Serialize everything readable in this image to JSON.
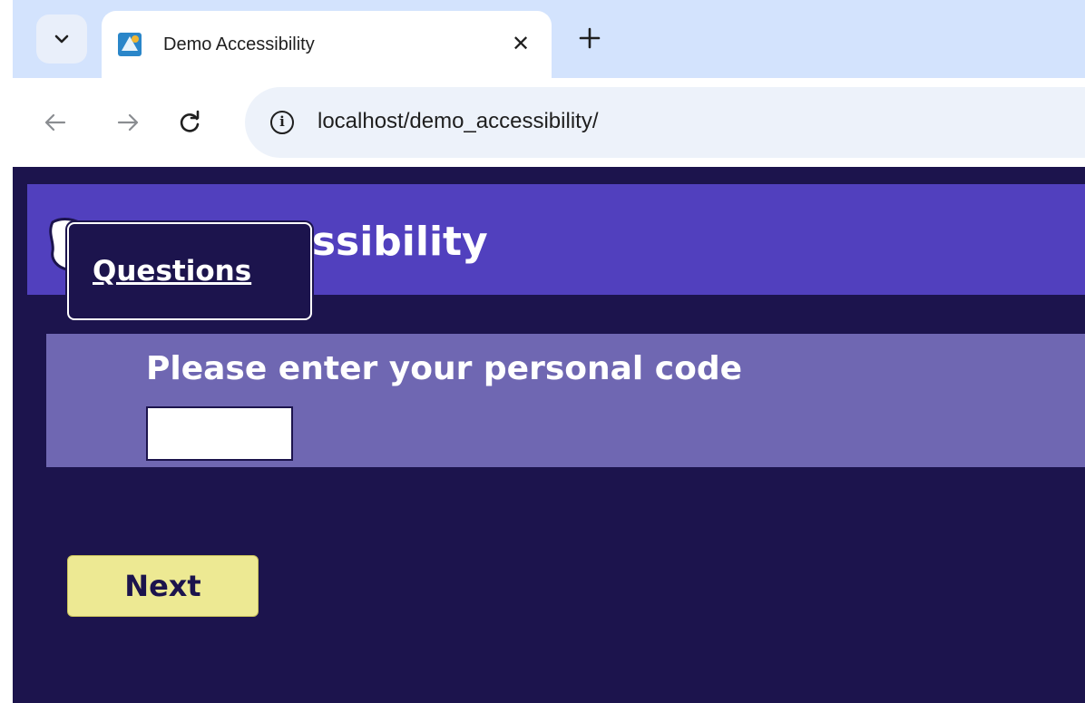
{
  "browser": {
    "tab": {
      "title": "Demo Accessibility",
      "favicon": "site-favicon",
      "close_glyph": "✕"
    },
    "new_tab_icon": "plus-icon",
    "tab_list_icon": "chevron-down-icon",
    "toolbar": {
      "back_icon": "arrow-left-icon",
      "forward_icon": "arrow-right-icon",
      "reload_icon": "reload-icon",
      "info_glyph": "i",
      "url": "localhost/demo_accessibility/"
    }
  },
  "page": {
    "header": {
      "title": "Demo Accessibility",
      "logo": "logo-icon"
    },
    "skip_link": {
      "label": "Questions"
    },
    "form": {
      "label": "Please enter your personal code",
      "code_value": "",
      "code_placeholder": ""
    },
    "next_button": {
      "label": "Next"
    }
  },
  "colors": {
    "chrome_tabstrip": "#d3e3fd",
    "omnibox": "#edf2fa",
    "page_background": "#1c144d",
    "header_background": "#5140be",
    "form_panel": "#6f67b2",
    "next_button": "#ede993"
  }
}
